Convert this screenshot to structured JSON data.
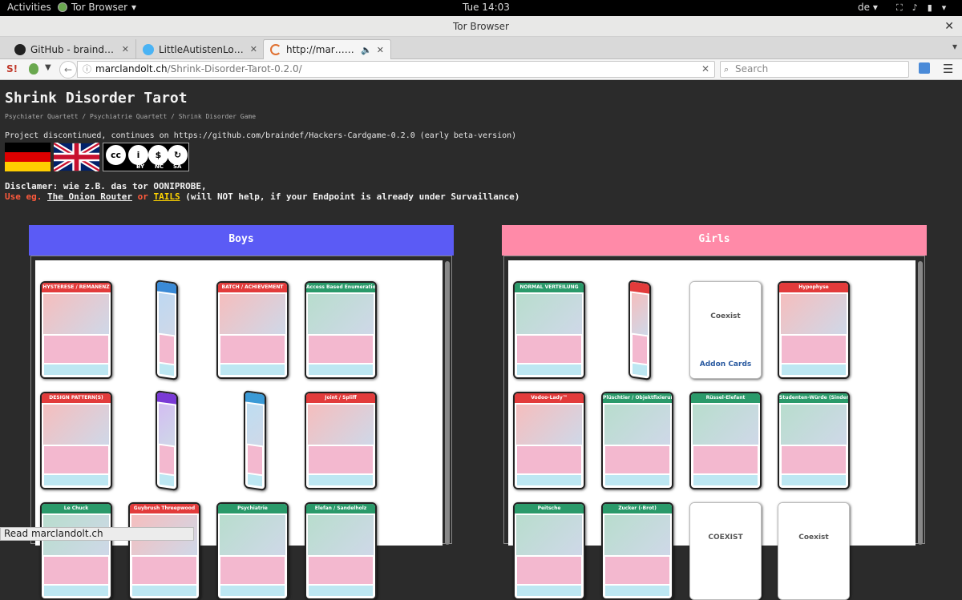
{
  "topbar": {
    "activities": "Activities",
    "app_menu": "Tor Browser",
    "clock": "Tue 14:03",
    "lang": "de"
  },
  "window": {
    "title": "Tor Browser"
  },
  "tabs": [
    {
      "label": "GitHub - braindef/Ha…",
      "favicon": "github-icon"
    },
    {
      "label": "LittleAutistenLolita on…",
      "favicon": "twitter-icon"
    },
    {
      "label": "http://mar…ot-0.2.0/",
      "favicon": "loading-icon",
      "active": true
    }
  ],
  "navbar": {
    "url_host": "marclandolt.ch",
    "url_path": "/Shrink-Disorder-Tarot-0.2.0/",
    "search_placeholder": "Search"
  },
  "page": {
    "title": "Shrink Disorder Tarot",
    "subtitle": "Psychiater Quartett / Psychiatrie Quartett / Shrink Disorder Game",
    "discontinued": "Project discontinued, continues on https://github.com/braindef/Hackers-Cardgame-0.2.0 (early beta-version)",
    "license_labels": [
      "BY",
      "NC",
      "SA"
    ],
    "disclaimer": "Disclamer: wie z.B. das tor OONIPROBE,",
    "use_prefix": "Use eg.",
    "link_onion": "The Onion Router",
    "or": "or",
    "link_tails": "TAILS",
    "warning": "(will NOT help, if your Endpoint is already under Survaillance)"
  },
  "columns": {
    "boys": {
      "label": "Boys",
      "color": "#5b5bf5"
    },
    "girls": {
      "label": "Girls",
      "color": "#ff8aa8"
    }
  },
  "boys_cards": [
    {
      "title": "HYSTERESE / REMANENZ",
      "color": "#e23b3b"
    },
    {
      "title": "",
      "color": "#3a8ad6",
      "thin": true
    },
    {
      "title": "BATCH / ACHIEVEMENT",
      "color": "#e23b3b"
    },
    {
      "title": "Access Based Enumeration",
      "color": "#2a9a6a"
    },
    {
      "title": "DESIGN PATTERN(S)",
      "color": "#e23b3b"
    },
    {
      "title": "",
      "color": "#7a3ad6",
      "thin": true
    },
    {
      "title": "",
      "color": "#3a9ad6",
      "thin": true
    },
    {
      "title": "Joint / Spliff",
      "color": "#e23b3b"
    },
    {
      "title": "Le Chuck",
      "color": "#2a9a6a"
    },
    {
      "title": "Guybrush Threepwood",
      "color": "#e23b3b"
    },
    {
      "title": "Psychiatrie",
      "color": "#2a9a6a"
    },
    {
      "title": "Elefan / Sandelholz",
      "color": "#2a9a6a"
    }
  ],
  "girls_cards": [
    {
      "title": "NORMAL VERTEILUNG",
      "color": "#2a9a6a"
    },
    {
      "title": "",
      "color": "#e23b3b",
      "thin": true
    },
    {
      "addon": true,
      "logo": "Coexist",
      "label": "Addon Cards"
    },
    {
      "title": "Hypophyse",
      "color": "#e23b3b"
    },
    {
      "title": "Vodoo-Lady™",
      "color": "#e23b3b"
    },
    {
      "title": "Plüschtier / Objektfixierung",
      "color": "#2a9a6a"
    },
    {
      "title": "Rüssel-Elefant",
      "color": "#2a9a6a"
    },
    {
      "title": "Studenten-Würde (Sindenbock)",
      "color": "#2a9a6a"
    },
    {
      "title": "Peitsche",
      "color": "#2a9a6a"
    },
    {
      "title": "Zucker (-Brot)",
      "color": "#2a9a6a"
    },
    {
      "addon": true,
      "logo": "COEXIST",
      "label": ""
    },
    {
      "addon": true,
      "logo": "Coexist",
      "label": ""
    }
  ],
  "status": "Read marclandolt.ch"
}
